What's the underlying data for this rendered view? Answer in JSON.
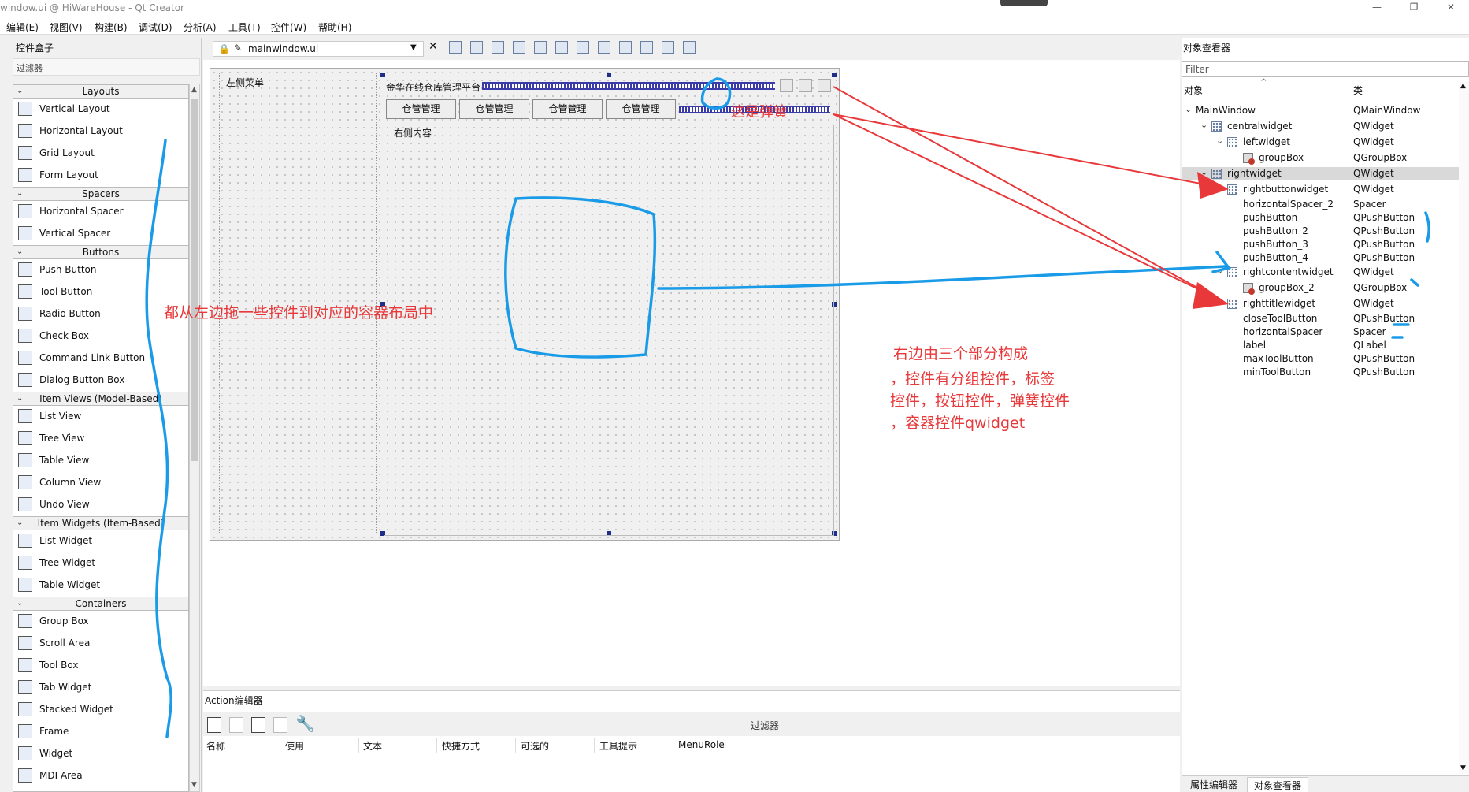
{
  "window": {
    "title": "window.ui @ HiWareHouse - Qt Creator",
    "min": "—",
    "max": "❐",
    "close": "✕"
  },
  "menu": [
    "编辑(E)",
    "视图(V)",
    "构建(B)",
    "调试(D)",
    "分析(A)",
    "工具(T)",
    "控件(W)",
    "帮助(H)"
  ],
  "widget_box": {
    "title": "控件盒子",
    "filter_placeholder": "过滤器",
    "categories": [
      {
        "name": "Layouts",
        "items": [
          "Vertical Layout",
          "Horizontal Layout",
          "Grid Layout",
          "Form Layout"
        ]
      },
      {
        "name": "Spacers",
        "items": [
          "Horizontal Spacer",
          "Vertical Spacer"
        ]
      },
      {
        "name": "Buttons",
        "items": [
          "Push Button",
          "Tool Button",
          "Radio Button",
          "Check Box",
          "Command Link Button",
          "Dialog Button Box"
        ]
      },
      {
        "name": "Item Views (Model-Based)",
        "items": [
          "List View",
          "Tree View",
          "Table View",
          "Column View",
          "Undo View"
        ]
      },
      {
        "name": "Item Widgets (Item-Based)",
        "items": [
          "List Widget",
          "Tree Widget",
          "Table Widget"
        ]
      },
      {
        "name": "Containers",
        "items": [
          "Group Box",
          "Scroll Area",
          "Tool Box",
          "Tab Widget",
          "Stacked Widget",
          "Frame",
          "Widget",
          "MDI Area"
        ]
      }
    ]
  },
  "editor": {
    "file_name": "mainwindow.ui",
    "form": {
      "left_menu_label": "左侧菜单",
      "title_label": "金华在线仓库管理平台",
      "nav_buttons": [
        "仓管管理",
        "仓管管理",
        "仓管管理",
        "仓管管理"
      ],
      "content_label": "右侧内容"
    }
  },
  "action_editor": {
    "title": "Action编辑器",
    "filter_label": "过滤器",
    "columns": [
      "名称",
      "使用",
      "文本",
      "快捷方式",
      "可选的",
      "工具提示",
      "MenuRole"
    ]
  },
  "object_inspector": {
    "title": "对象查看器",
    "filter_placeholder": "Filter",
    "col_object": "对象",
    "col_class": "类",
    "rows": [
      {
        "name": "MainWindow",
        "class": "QMainWindow"
      },
      {
        "name": "centralwidget",
        "class": "QWidget"
      },
      {
        "name": "leftwidget",
        "class": "QWidget"
      },
      {
        "name": "groupBox",
        "class": "QGroupBox"
      },
      {
        "name": "rightwidget",
        "class": "QWidget"
      },
      {
        "name": "rightbuttonwidget",
        "class": "QWidget"
      },
      {
        "name": "horizontalSpacer_2",
        "class": "Spacer"
      },
      {
        "name": "pushButton",
        "class": "QPushButton"
      },
      {
        "name": "pushButton_2",
        "class": "QPushButton"
      },
      {
        "name": "pushButton_3",
        "class": "QPushButton"
      },
      {
        "name": "pushButton_4",
        "class": "QPushButton"
      },
      {
        "name": "rightcontentwidget",
        "class": "QWidget"
      },
      {
        "name": "groupBox_2",
        "class": "QGroupBox"
      },
      {
        "name": "righttitlewidget",
        "class": "QWidget"
      },
      {
        "name": "closeToolButton",
        "class": "QPushButton"
      },
      {
        "name": "horizontalSpacer",
        "class": "Spacer"
      },
      {
        "name": "label",
        "class": "QLabel"
      },
      {
        "name": "maxToolButton",
        "class": "QPushButton"
      },
      {
        "name": "minToolButton",
        "class": "QPushButton"
      }
    ],
    "tabs": [
      "属性编辑器",
      "对象查看器"
    ]
  },
  "annotations": {
    "spring_note": "这是弹簧",
    "drag_note": "都从左边拖一些控件到对应的容器布局中",
    "right_note_lines": [
      "右边由三个部分构成",
      "，控件有分组控件，标签",
      "控件，按钮控件，弹簧控件",
      "，容器控件qwidget"
    ],
    "colors": {
      "red": "#e8383a",
      "blue": "#1a9be8"
    }
  }
}
